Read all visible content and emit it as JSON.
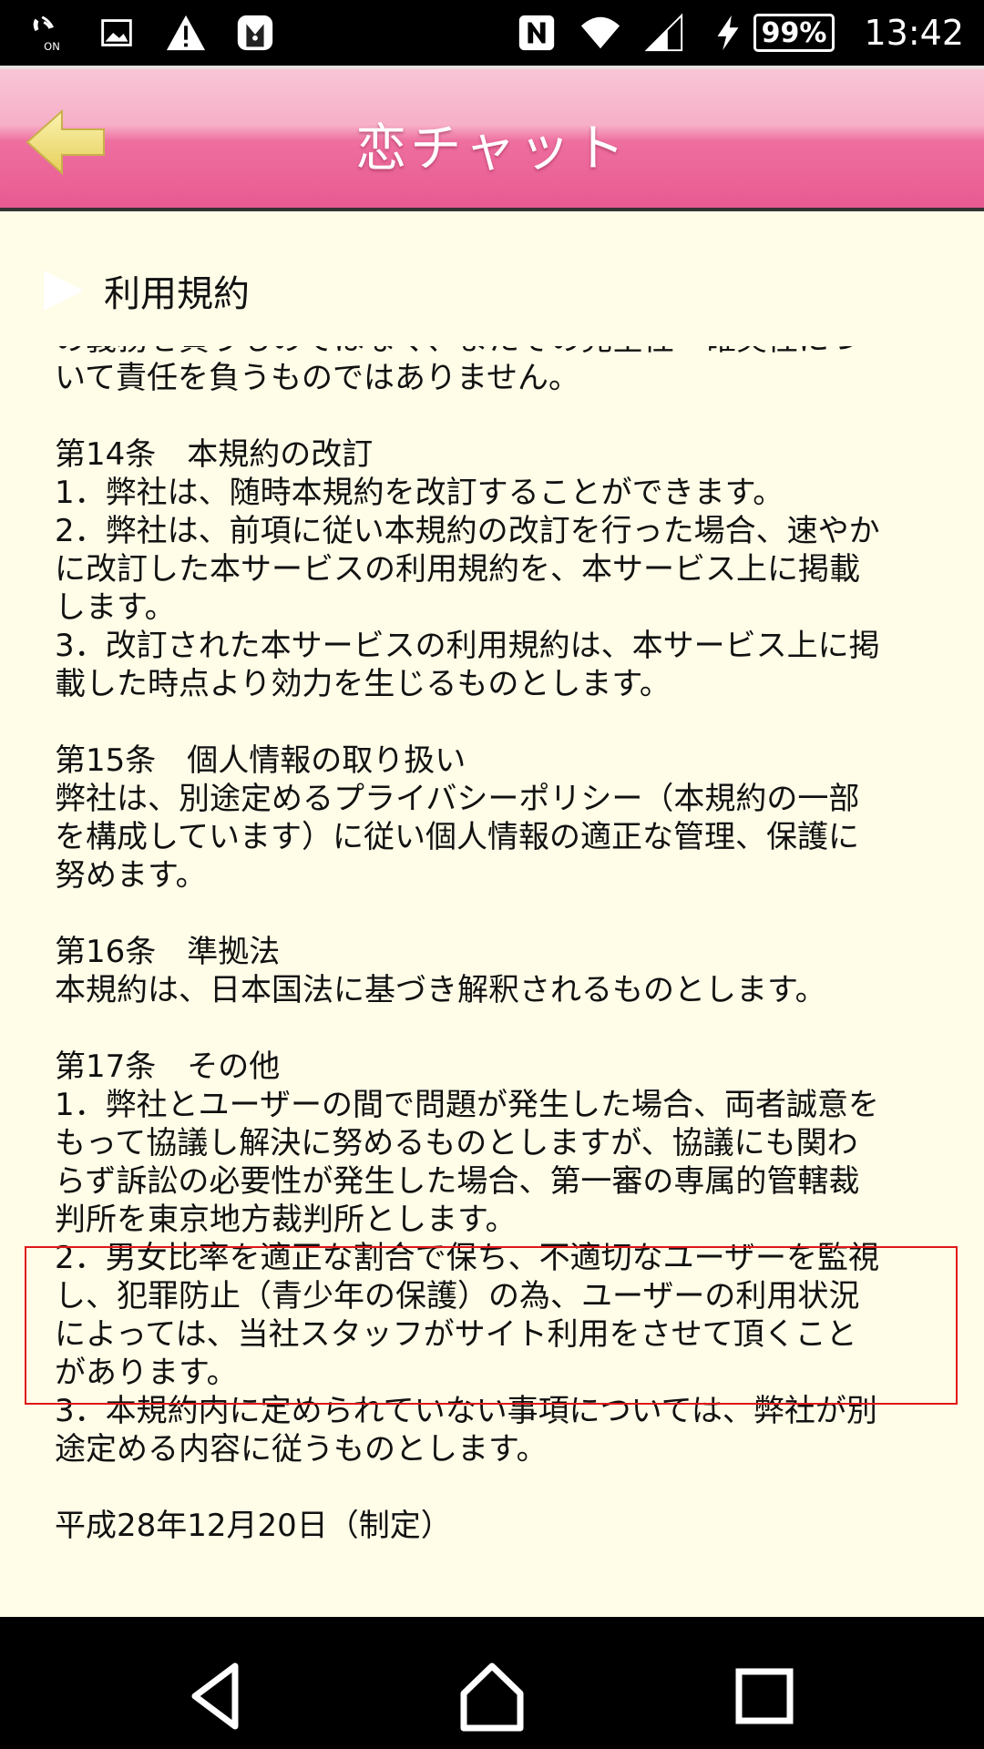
{
  "status_bar": {
    "left_icons": [
      "wifi-calling-on-icon",
      "image-icon",
      "warning-icon",
      "app-notification-icon"
    ],
    "right_icons": [
      "nfc-icon",
      "wifi-icon",
      "signal-icon",
      "charging-icon"
    ],
    "battery": "99%",
    "time": "13:42"
  },
  "header": {
    "title": "恋チャット",
    "back_icon": "back-arrow-icon"
  },
  "section": {
    "title": "利用規約",
    "icon": "play-arrow-icon"
  },
  "terms": {
    "lines": [
      "の義務を負うものではなく、またその完全性・確実性につ",
      "いて責任を負うものではありません。",
      "",
      "第14条　本規約の改訂",
      "1．弊社は、随時本規約を改訂することができます。",
      "2．弊社は、前項に従い本規約の改訂を行った場合、速やか",
      "に改訂した本サービスの利用規約を、本サービス上に掲載",
      "します。",
      "3．改訂された本サービスの利用規約は、本サービス上に掲",
      "載した時点より効力を生じるものとします。",
      "",
      "第15条　個人情報の取り扱い",
      "弊社は、別途定めるプライバシーポリシー（本規約の一部",
      "を構成しています）に従い個人情報の適正な管理、保護に",
      "努めます。",
      "",
      "第16条　準拠法",
      "本規約は、日本国法に基づき解釈されるものとします。",
      "",
      "第17条　その他",
      "1．弊社とユーザーの間で問題が発生した場合、両者誠意を",
      "もって協議し解決に努めるものとしますが、協議にも関わ",
      "らず訴訟の必要性が発生した場合、第一審の専属的管轄裁",
      "判所を東京地方裁判所とします。",
      "2．男女比率を適正な割合で保ち、不適切なユーザーを監視",
      "し、犯罪防止（青少年の保護）の為、ユーザーの利用状況",
      "によっては、当社スタッフがサイト利用をさせて頂くこと",
      "があります。",
      "3．本規約内に定められていない事項については、弊社が別",
      "途定める内容に従うものとします。",
      "",
      "平成28年12月20日（制定）"
    ]
  },
  "nav_bar": {
    "back": "back-triangle-icon",
    "home": "home-icon",
    "recents": "recents-square-icon"
  },
  "colors": {
    "header_pink": "#e85a91",
    "background": "#fffde8",
    "highlight_red": "#e01818",
    "back_arrow": "#f2e38a"
  }
}
